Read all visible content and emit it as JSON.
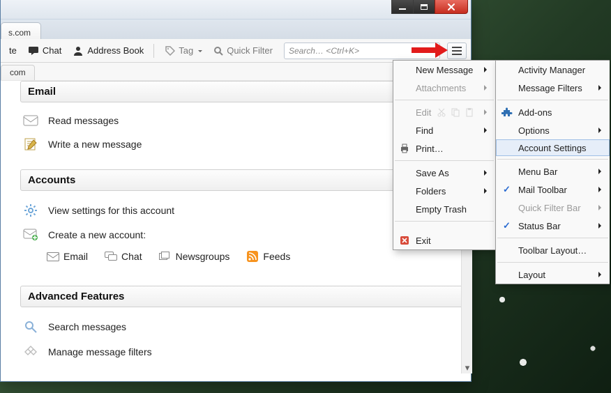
{
  "tab_suffix": "s.com",
  "toolbar": {
    "write": "te",
    "chat": "Chat",
    "address_book": "Address Book",
    "tag": "Tag",
    "quick_filter": "Quick Filter",
    "search_placeholder": "Search… <Ctrl+K>"
  },
  "subtab": "com",
  "sections": {
    "email_head": "Email",
    "read_messages": "Read messages",
    "write_message": "Write a new message",
    "accounts_head": "Accounts",
    "view_settings": "View settings for this account",
    "create_account": "Create a new account:",
    "acct_email": "Email",
    "acct_chat": "Chat",
    "acct_newsgroups": "Newsgroups",
    "acct_feeds": "Feeds",
    "advanced_head": "Advanced Features",
    "search_messages": "Search messages",
    "manage_filters": "Manage message filters"
  },
  "menu1": {
    "new_message": "New Message",
    "attachments": "Attachments",
    "edit": "Edit",
    "find": "Find",
    "print": "Print…",
    "save_as": "Save As",
    "folders": "Folders",
    "empty_trash": "Empty Trash",
    "exit": "Exit"
  },
  "menu2": {
    "activity_manager": "Activity Manager",
    "message_filters": "Message Filters",
    "addons": "Add-ons",
    "options": "Options",
    "account_settings": "Account Settings",
    "menu_bar": "Menu Bar",
    "mail_toolbar": "Mail Toolbar",
    "quick_filter_bar": "Quick Filter Bar",
    "status_bar": "Status Bar",
    "toolbar_layout": "Toolbar Layout…",
    "layout": "Layout"
  }
}
